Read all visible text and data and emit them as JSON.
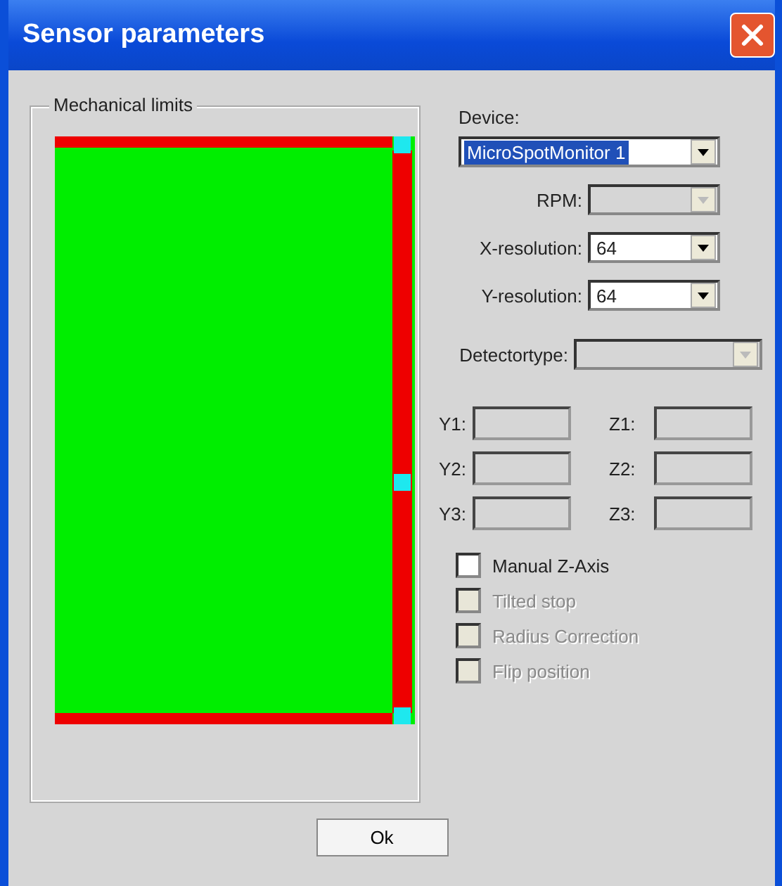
{
  "window": {
    "title": "Sensor parameters"
  },
  "limits": {
    "title": "Mechanical limits"
  },
  "device": {
    "label": "Device:",
    "value": "MicroSpotMonitor 1",
    "focused": true
  },
  "combos": [
    {
      "label": "RPM:",
      "disabled": true,
      "kind": "short"
    },
    {
      "label": "X-resolution:",
      "value": "64",
      "disabled": false,
      "kind": "short"
    },
    {
      "label": "Y-resolution:",
      "value": "64",
      "disabled": false,
      "kind": "short"
    },
    {
      "label": "Detectortype:",
      "disabled": true,
      "kind": "wide"
    }
  ],
  "coordinates": [
    {
      "label": "Y1:",
      "disabled": true
    },
    {
      "label": "Z1:",
      "disabled": true
    },
    {
      "label": "Y2:",
      "disabled": true
    },
    {
      "label": "Z2:",
      "disabled": true
    },
    {
      "label": "Y3:",
      "disabled": true
    },
    {
      "label": "Z3:",
      "disabled": true
    }
  ],
  "checkboxes": [
    {
      "label": "Manual Z-Axis",
      "checked": false,
      "disabled": false
    },
    {
      "label": "Tilted stop",
      "checked": false,
      "disabled": true
    },
    {
      "label": "Radius Correction",
      "checked": false,
      "disabled": true
    },
    {
      "label": "Flip position",
      "checked": false,
      "disabled": true
    }
  ],
  "buttons": [
    "Ok"
  ]
}
